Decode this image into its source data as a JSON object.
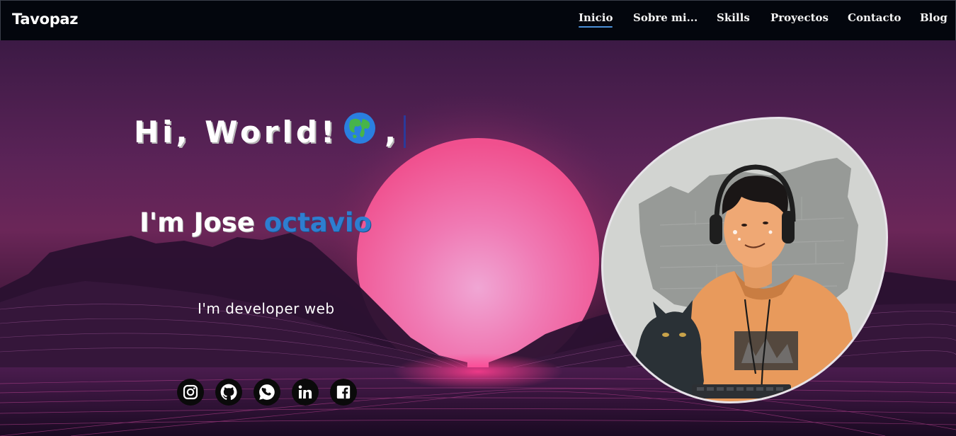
{
  "brand": "Tavopaz",
  "nav": {
    "items": [
      {
        "label": "Inicio",
        "active": true
      },
      {
        "label": "Sobre mi...",
        "active": false
      },
      {
        "label": "Skills",
        "active": false
      },
      {
        "label": "Proyectos",
        "active": false
      },
      {
        "label": "Contacto",
        "active": false
      },
      {
        "label": "Blog",
        "active": false
      }
    ]
  },
  "hero": {
    "greeting": "Hi, World!",
    "greeting_suffix": ",",
    "greeting_icon": "globe-icon",
    "intro_prefix": "I'm Jose",
    "intro_accent": "octavio",
    "tagline": "I'm developer web",
    "avatar_icon": "avatar-illustration"
  },
  "social": [
    {
      "name": "instagram",
      "icon": "instagram-icon"
    },
    {
      "name": "github",
      "icon": "github-icon"
    },
    {
      "name": "whatsapp",
      "icon": "whatsapp-icon"
    },
    {
      "name": "linkedin",
      "icon": "linkedin-icon"
    },
    {
      "name": "facebook",
      "icon": "facebook-icon"
    }
  ],
  "colors": {
    "nav_background": "#03060d",
    "nav_active_underline": "#4a8fd8",
    "accent_text": "#2e7ed0",
    "sun_pink": "#f0609a",
    "avatar_background": "#d2d4d1"
  }
}
